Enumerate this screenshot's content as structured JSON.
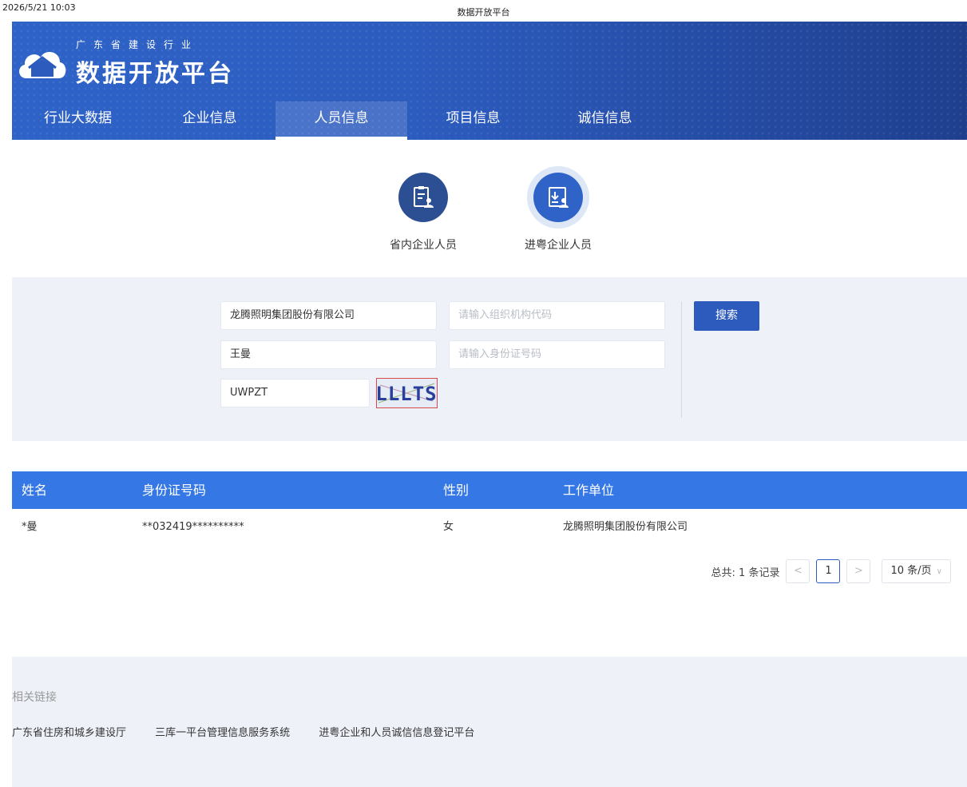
{
  "print": {
    "date": "2026/5/21 10:03",
    "title": "数据开放平台"
  },
  "header": {
    "logo_sub": "广东省建设行业",
    "logo_main": "数据开放平台",
    "nav": [
      "行业大数据",
      "企业信息",
      "人员信息",
      "项目信息",
      "诚信信息"
    ],
    "active_nav": "人员信息"
  },
  "modes": [
    {
      "label": "省内企业人员",
      "icon": "person-id-card-icon"
    },
    {
      "label": "进粤企业人员",
      "icon": "person-import-icon"
    }
  ],
  "active_mode": "进粤企业人员",
  "search": {
    "company_value": "龙腾照明集团股份有限公司",
    "org_code_placeholder": "请输入组织机构代码",
    "name_value": "王曼",
    "id_placeholder": "请输入身份证号码",
    "captcha_input_value": "UWPZT",
    "captcha_text": "LLLTS",
    "button_label": "搜索"
  },
  "table": {
    "headers": [
      "姓名",
      "身份证号码",
      "性别",
      "工作单位"
    ],
    "rows": [
      [
        "*曼",
        "**032419**********",
        "女",
        "龙腾照明集团股份有限公司"
      ]
    ]
  },
  "pagination": {
    "total_text": "总共: 1 条记录",
    "prev": "<",
    "current_page": "1",
    "next": ">",
    "page_size": "10 条/页"
  },
  "footer": {
    "title": "相关链接",
    "links": [
      "广东省住房和城乡建设厅",
      "三库一平台管理信息服务系统",
      "进粤企业和人员诚信信息登记平台"
    ]
  },
  "colors": {
    "primary": "#2c5bbd",
    "table_header": "#3578e5",
    "panel_bg": "#eef2f8"
  }
}
